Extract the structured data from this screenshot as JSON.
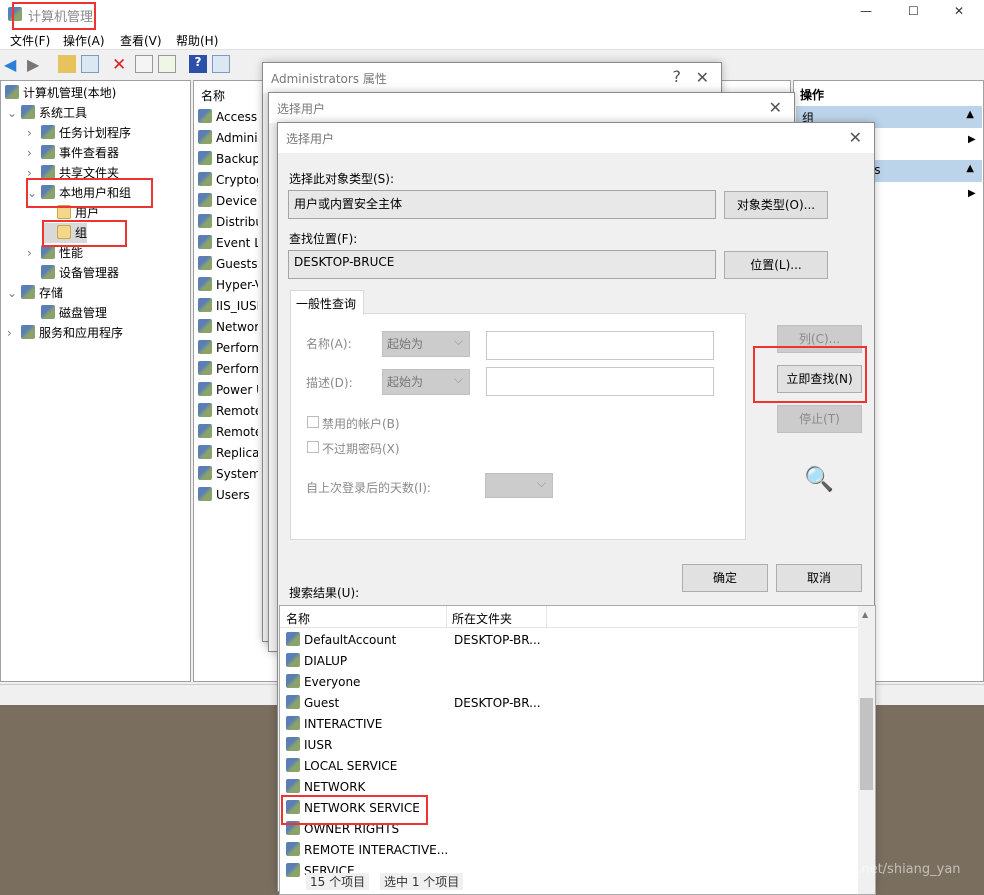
{
  "window": {
    "title": "计算机管理",
    "controls": [
      "—",
      "☐",
      "✕"
    ]
  },
  "menu": [
    "文件(F)",
    "操作(A)",
    "查看(V)",
    "帮助(H)"
  ],
  "toolbar": [
    "back-icon",
    "forward-icon",
    "up-folder-icon",
    "show-tree-icon",
    "delete-icon",
    "properties-icon",
    "export-icon",
    "help-icon",
    "show-action-pane-icon"
  ],
  "tree": {
    "root": "计算机管理(本地)",
    "items": [
      {
        "label": "系统工具",
        "level": 1,
        "exp": "⌄"
      },
      {
        "label": "任务计划程序",
        "level": 2,
        "exp": "›"
      },
      {
        "label": "事件查看器",
        "level": 2,
        "exp": "›"
      },
      {
        "label": "共享文件夹",
        "level": 2,
        "exp": "›"
      },
      {
        "label": "本地用户和组",
        "level": 2,
        "exp": "⌄"
      },
      {
        "label": "用户",
        "level": 3,
        "exp": ""
      },
      {
        "label": "组",
        "level": 3,
        "exp": "",
        "selected": true
      },
      {
        "label": "性能",
        "level": 2,
        "exp": "›"
      },
      {
        "label": "设备管理器",
        "level": 2,
        "exp": ""
      },
      {
        "label": "存储",
        "level": 1,
        "exp": "⌄"
      },
      {
        "label": "磁盘管理",
        "level": 2,
        "exp": ""
      },
      {
        "label": "服务和应用程序",
        "level": 1,
        "exp": "›"
      }
    ]
  },
  "list": {
    "header": "名称",
    "items": [
      "Access",
      "Adminis",
      "Backup",
      "Cryptog",
      "Device",
      "Distribu",
      "Event Lo",
      "Guests",
      "Hyper-V",
      "IIS_IUSR",
      "Networ",
      "Perform",
      "Perform",
      "Power U",
      "Remote",
      "Remote",
      "Replicat",
      "System",
      "Users"
    ]
  },
  "actions": {
    "header": "操作",
    "sections": [
      "组",
      "ors"
    ]
  },
  "dialog_back": {
    "title": "Administrators 属性"
  },
  "dialog_mid": {
    "title": "选择用户"
  },
  "dialog": {
    "title": "选择用户",
    "object_type_label": "选择此对象类型(S):",
    "object_type_value": "用户或内置安全主体",
    "object_type_button": "对象类型(O)...",
    "location_label": "查找位置(F):",
    "location_value": "DESKTOP-BRUCE",
    "location_button": "位置(L)...",
    "tab": "一般性查询",
    "name_label": "名称(A):",
    "name_mode": "起始为",
    "desc_label": "描述(D):",
    "desc_mode": "起始为",
    "disabled_accounts": "禁用的帐户(B)",
    "non_expiring": "不过期密码(X)",
    "days_label": "自上次登录后的天数(I):",
    "columns_button": "列(C)...",
    "find_now_button": "立即查找(N)",
    "stop_button": "停止(T)",
    "ok_button": "确定",
    "cancel_button": "取消",
    "results_label": "搜索结果(U):",
    "results_headers": [
      "名称",
      "所在文件夹"
    ],
    "results": [
      {
        "name": "DefaultAccount",
        "folder": "DESKTOP-BR...",
        "type": "user"
      },
      {
        "name": "DIALUP",
        "folder": "",
        "type": "group"
      },
      {
        "name": "Everyone",
        "folder": "",
        "type": "group"
      },
      {
        "name": "Guest",
        "folder": "DESKTOP-BR...",
        "type": "user"
      },
      {
        "name": "INTERACTIVE",
        "folder": "",
        "type": "group"
      },
      {
        "name": "IUSR",
        "folder": "",
        "type": "group"
      },
      {
        "name": "LOCAL SERVICE",
        "folder": "",
        "type": "group"
      },
      {
        "name": "NETWORK",
        "folder": "",
        "type": "group"
      },
      {
        "name": "NETWORK SERVICE",
        "folder": "",
        "type": "group"
      },
      {
        "name": "OWNER RIGHTS",
        "folder": "",
        "type": "group"
      },
      {
        "name": "REMOTE INTERACTIVE...",
        "folder": "",
        "type": "group"
      },
      {
        "name": "SERVICE",
        "folder": "",
        "type": "group"
      }
    ]
  },
  "statusbar": [
    "15 个项目",
    "选中 1 个项目"
  ],
  "watermark": "https://blog.csdn.net/shiang_yan",
  "colors": {
    "highlight": "#ee3333",
    "action_header": "#bcd4ea",
    "desktop": "#7a6f5f"
  }
}
